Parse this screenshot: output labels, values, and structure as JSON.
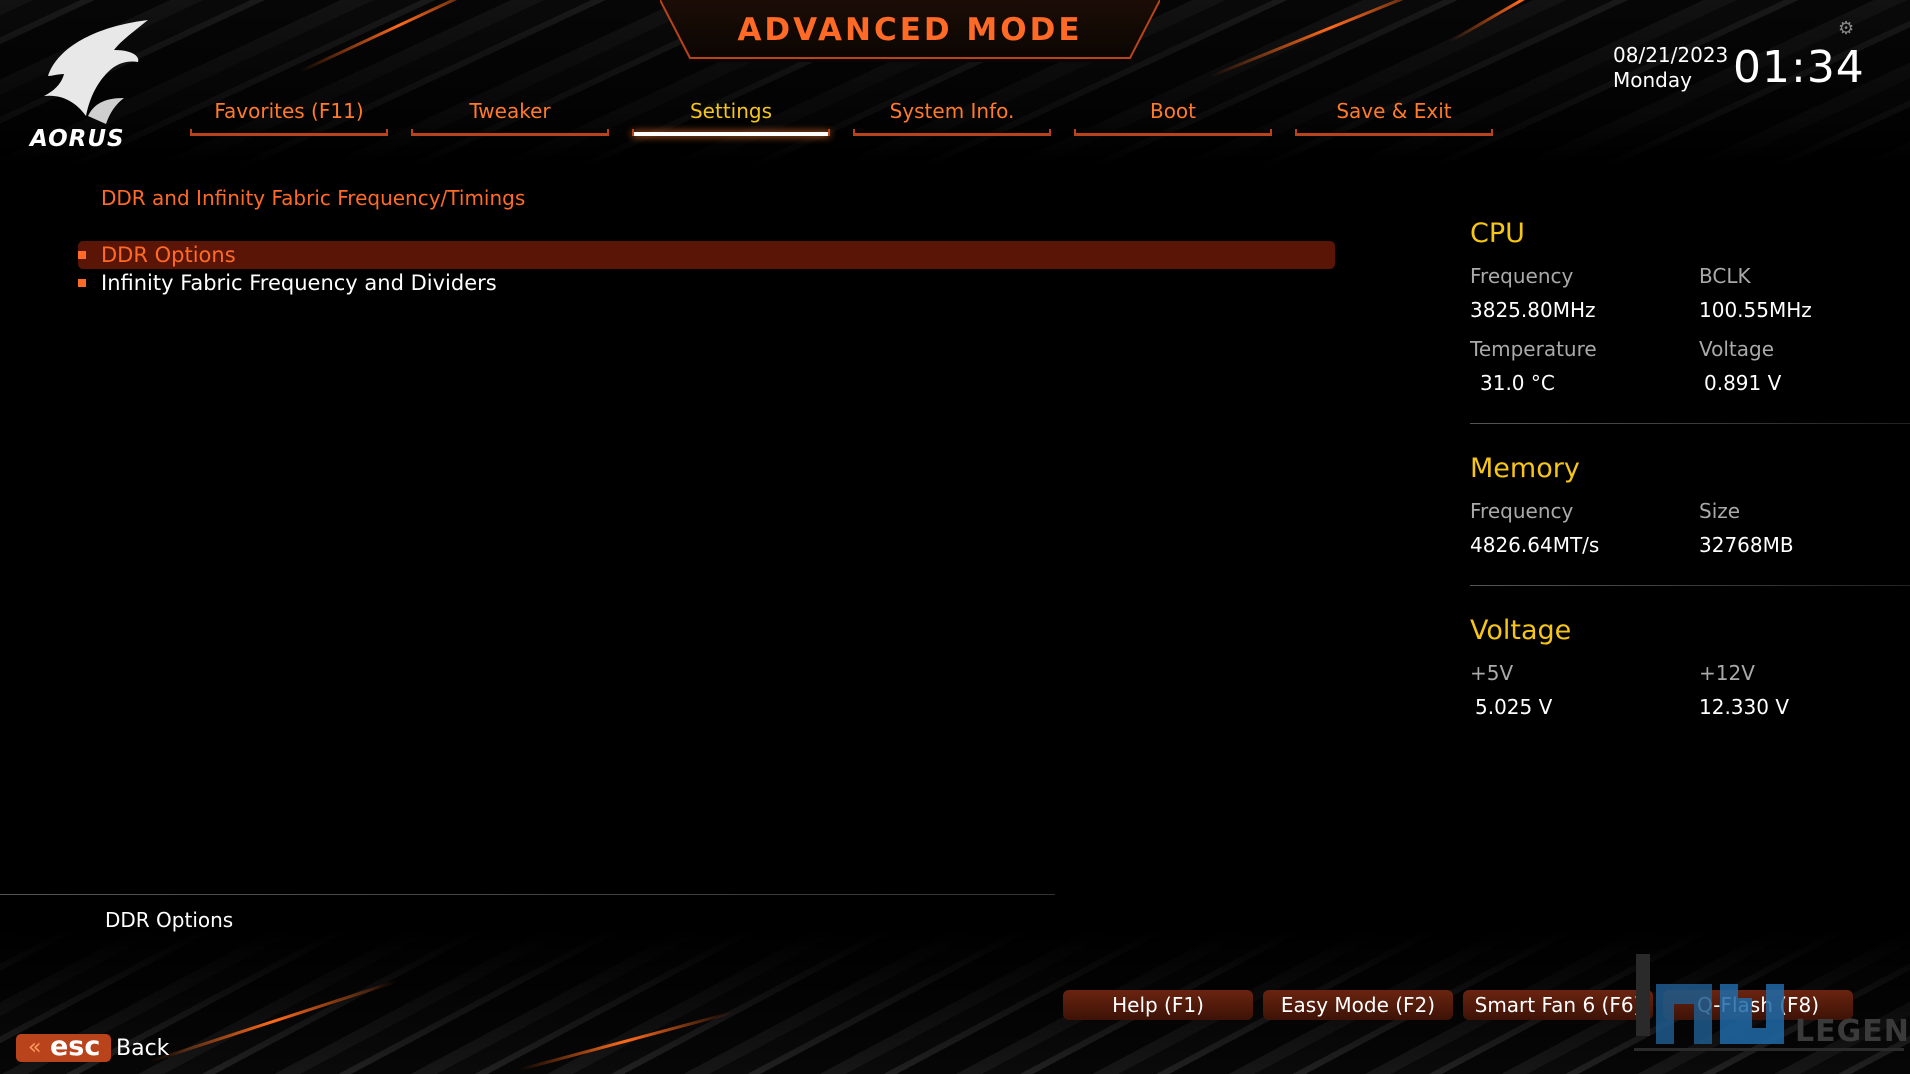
{
  "header": {
    "title": "ADVANCED MODE",
    "logo_text": "AORUS",
    "date": "08/21/2023",
    "day": "Monday",
    "time": "01:34"
  },
  "tabs": [
    {
      "label": "Favorites (F11)",
      "active": false
    },
    {
      "label": "Tweaker",
      "active": false
    },
    {
      "label": "Settings",
      "active": true
    },
    {
      "label": "System Info.",
      "active": false
    },
    {
      "label": "Boot",
      "active": false
    },
    {
      "label": "Save & Exit",
      "active": false
    }
  ],
  "main": {
    "breadcrumb": "DDR and Infinity Fabric Frequency/Timings",
    "items": [
      {
        "label": "DDR Options",
        "selected": true
      },
      {
        "label": "Infinity Fabric Frequency and Dividers",
        "selected": false
      }
    ],
    "description": "DDR Options"
  },
  "status": {
    "cpu": {
      "title": "CPU",
      "frequency_label": "Frequency",
      "frequency": "3825.80MHz",
      "bclk_label": "BCLK",
      "bclk": "100.55MHz",
      "temperature_label": "Temperature",
      "temperature": "31.0 °C",
      "voltage_label": "Voltage",
      "voltage": "0.891 V"
    },
    "memory": {
      "title": "Memory",
      "frequency_label": "Frequency",
      "frequency": "4826.64MT/s",
      "size_label": "Size",
      "size": "32768MB"
    },
    "voltage": {
      "title": "Voltage",
      "v5_label": "+5V",
      "v5": "5.025 V",
      "v12_label": "+12V",
      "v12": "12.330 V"
    }
  },
  "footer": {
    "help": "Help (F1)",
    "easy_mode": "Easy Mode (F2)",
    "smart_fan": "Smart Fan 6 (F6)",
    "qflash": "Q-Flash (F8)",
    "esc": "esc",
    "back": "Back"
  },
  "watermark": {
    "text": "LEGEND"
  },
  "colors": {
    "accent_orange": "#ff6a26",
    "active_yellow": "#f5c518",
    "selected_bg": "#5a1507",
    "button_bg": "#6a2410"
  }
}
